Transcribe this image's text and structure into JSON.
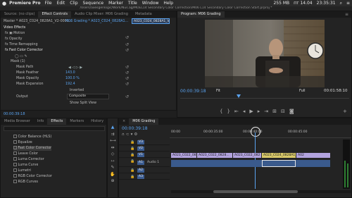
{
  "menubar": {
    "apple": "",
    "app": "Premiere Pro",
    "items": [
      "File",
      "Edit",
      "Clip",
      "Sequence",
      "Marker",
      "Title",
      "Window",
      "Help"
    ],
    "memory": "255 MB",
    "date": "пт 14.04",
    "time": "23:35:31"
  },
  "pathbar": "/Users/axesgenlogic/Work/Nus.ag/MOEL14 Secondary Color Correction/M06 L14 Secondary Color Correction Start.prproj *",
  "effect_panel": {
    "tabs": [
      "Source: (no clips)",
      "Effect Controls",
      "Audio Clip Mixer: M06 Grading",
      "Metadata"
    ],
    "master": "Master * A023_C024_0828A1_V2-0001...",
    "seq": "M06 Grading * A023_C024_0828A1...",
    "clip_label": "A023_C024_0828A1_V2",
    "video_effects": "Video Effects",
    "rows": [
      {
        "label": "fx  ▣ Motion"
      },
      {
        "label": "fx  Opacity"
      },
      {
        "label": "fx  Time Remapping"
      },
      {
        "label": "fx  Fast Color Corrector"
      },
      {
        "label": "Mask (1)"
      },
      {
        "label": "Mask Path"
      },
      {
        "label": "Mask Feather",
        "value": "143.0"
      },
      {
        "label": "Mask Opacity",
        "value": "100.0 %"
      },
      {
        "label": "Mask Expansion",
        "value": "192.4"
      }
    ],
    "inverted": "Inverted",
    "output_label": "Output",
    "output_value": "Composite",
    "split": "Show Split View",
    "timecode": "00:00:39:18"
  },
  "program": {
    "title": "Program: M06 Grading",
    "timecode": "00:00:39:18",
    "fit": "Fit",
    "quality": "Full",
    "duration": "00:01:58:10"
  },
  "effects_panel": {
    "tabs": [
      "Media Browser",
      "Info",
      "Effects",
      "Markers",
      "History"
    ],
    "items": [
      "Color Balance (HLS)",
      "Equalize",
      "Fast Color Corrector",
      "Leave Color",
      "Luma Corrector",
      "Luma Curve",
      "Lumetri",
      "RGB Color Corrector",
      "RGB Curves"
    ]
  },
  "timeline": {
    "tab": "M06 Grading",
    "timecode": "00:00:39:18",
    "ruler": [
      "00:00",
      "00:00:35:00",
      "00:00:40:00",
      "00:00:45:00"
    ],
    "tracks": [
      "V3",
      "V2",
      "V1",
      "A1",
      "A2",
      "A3"
    ],
    "audio_label": "Audio 1",
    "clips": [
      "A023_C022_0828...",
      "A023_C022_082",
      "A023_C024_0828A1_V2"
    ],
    "fx_clip": "A02"
  },
  "colors": {
    "accent": "#5aa3f0",
    "clip_purple": "#b2a3de",
    "clip_yellow": "#d9c96a",
    "audio_blue": "#3a5a8c"
  }
}
